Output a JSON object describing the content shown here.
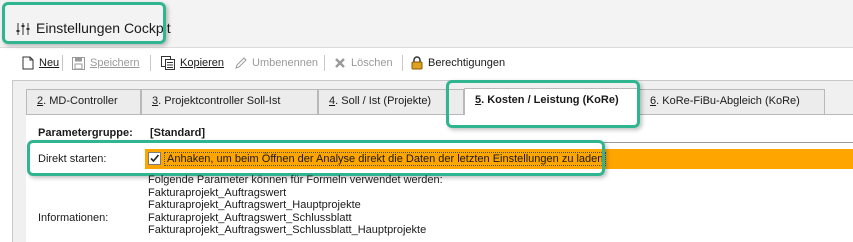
{
  "window": {
    "title": "Einstellungen Cockpit"
  },
  "toolbar": {
    "new_label": "Neu",
    "save_label": "Speichern",
    "copy_label": "Kopieren",
    "rename_label": "Umbenennen",
    "delete_label": "Löschen",
    "permissions_label": "Berechtigungen"
  },
  "tabs": [
    {
      "num": "2",
      "label": ". MD-Controller"
    },
    {
      "num": "3",
      "label": ". Projektcontroller Soll-Ist"
    },
    {
      "num": "4",
      "label": ". Soll / Ist (Projekte)"
    },
    {
      "num": "5",
      "label": ". Kosten / Leistung (KoRe)"
    },
    {
      "num": "6",
      "label": ". KoRe-FiBu-Abgleich (KoRe)"
    }
  ],
  "active_tab": "5. Kosten / Leistung (KoRe)",
  "form": {
    "parametergruppe_label": "Parametergruppe:",
    "parametergruppe_value": "[Standard]",
    "direkt_starten_label": "Direkt starten:",
    "direkt_starten_checked": true,
    "direkt_starten_text": "Anhaken, um beim Öffnen der Analyse direkt die Daten der letzten Einstellungen zu laden",
    "informationen_label": "Informationen:",
    "informationen_lines": [
      "Folgende Parameter können für Formeln verwendet werden:",
      "Fakturaprojekt_Auftragswert",
      "Fakturaprojekt_Auftragswert_Hauptprojekte",
      "Fakturaprojekt_Auftragswert_Schlussblatt",
      "Fakturaprojekt_Auftragswert_Schlussblatt_Hauptprojekte"
    ]
  },
  "colors": {
    "highlight": "#2fb58f",
    "checkbox_row": "#ffa500"
  }
}
